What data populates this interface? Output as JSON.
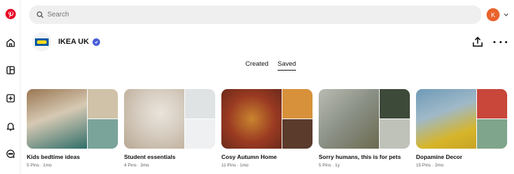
{
  "colors": {
    "brand": "#e60023",
    "avatar": "#e9622b",
    "verified": "#4a5fd8"
  },
  "sidebar": {
    "icons": [
      "pinterest-logo-icon",
      "home-icon",
      "explore-icon",
      "create-icon",
      "notifications-icon",
      "messages-icon"
    ]
  },
  "search": {
    "placeholder": "Search",
    "value": ""
  },
  "user": {
    "avatar_letter": "K"
  },
  "profile": {
    "name": "IKEA UK",
    "verified": true
  },
  "tabs": [
    {
      "label": "Created",
      "active": false
    },
    {
      "label": "Saved",
      "active": true
    }
  ],
  "boards": [
    {
      "title": "Kids bedtime ideas",
      "meta": "5 Pins · 1mo",
      "colors": [
        "#8b6b4a",
        "#cfc2a8",
        "#2f6e6a"
      ]
    },
    {
      "title": "Student essentials",
      "meta": "4 Pins · 3mo",
      "colors": [
        "#d8cfc3",
        "#c9cfd0",
        "#eef0f2"
      ]
    },
    {
      "title": "Cosy Autumn Home",
      "meta": "11 Pins · 1mo",
      "colors": [
        "#9a3a22",
        "#c9852f",
        "#5a3b2c"
      ]
    },
    {
      "title": "Sorry humans, this is for pets",
      "meta": "5 Pins · 1y",
      "colors": [
        "#8a8f85",
        "#6b6a4e",
        "#bfc2b8"
      ]
    },
    {
      "title": "Dopamine Decor",
      "meta": "15 Pins · 2mo",
      "colors": [
        "#d7b52a",
        "#c8463a",
        "#7fa58c"
      ]
    }
  ]
}
